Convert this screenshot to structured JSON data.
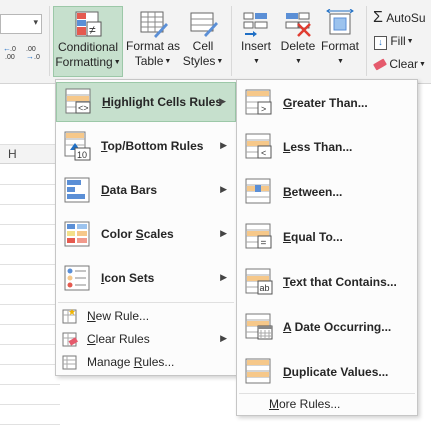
{
  "ribbon": {
    "number_format": {
      "decrease_decimal": "←.0 .00",
      "increase_decimal": ".00 →.0"
    },
    "buttons": {
      "conditional_formatting": {
        "line1": "Conditional",
        "line2": "Formatting"
      },
      "format_as_table": {
        "line1": "Format as",
        "line2": "Table"
      },
      "cell_styles": {
        "line1": "Cell",
        "line2": "Styles"
      },
      "insert": {
        "line1": "Insert"
      },
      "delete": {
        "line1": "Delete"
      },
      "format": {
        "line1": "Format"
      }
    },
    "editing": {
      "autosum": "AutoSu",
      "fill": "Fill",
      "clear": "Clear"
    }
  },
  "sheet": {
    "column_header": "H"
  },
  "menu": {
    "items": [
      {
        "label": "Highlight Cells Rules",
        "u": "H",
        "rest": "ighlight Cells Rules"
      },
      {
        "label": "Top/Bottom Rules",
        "u": "T",
        "rest": "op/Bottom Rules"
      },
      {
        "label": "Data Bars",
        "u": "D",
        "rest": "ata Bars"
      },
      {
        "label": "Color Scales",
        "u": "S",
        "pre": "Color ",
        "rest": "cales"
      },
      {
        "label": "Icon Sets",
        "u": "I",
        "rest": "con Sets"
      }
    ],
    "small_items": [
      {
        "label": "New Rule...",
        "u": "N",
        "rest": "ew Rule..."
      },
      {
        "label": "Clear Rules",
        "u": "C",
        "rest": "lear Rules"
      },
      {
        "label": "Manage Rules...",
        "pre": "Manage ",
        "u": "R",
        "rest": "ules..."
      }
    ]
  },
  "submenu": {
    "items": [
      {
        "label": "Greater Than...",
        "u": "G",
        "rest": "reater Than..."
      },
      {
        "label": "Less Than...",
        "u": "L",
        "rest": "ess Than..."
      },
      {
        "label": "Between...",
        "u": "B",
        "rest": "etween..."
      },
      {
        "label": "Equal To...",
        "u": "E",
        "rest": "qual To..."
      },
      {
        "label": "Text that Contains...",
        "u": "T",
        "rest": "ext that Contains..."
      },
      {
        "label": "A Date Occurring...",
        "u": "A",
        "rest": " Date Occurring..."
      },
      {
        "label": "Duplicate Values...",
        "u": "D",
        "rest": "uplicate Values..."
      }
    ],
    "more_rules": {
      "label": "More Rules...",
      "pre": "",
      "u": "M",
      "rest": "ore Rules..."
    }
  },
  "colors": {
    "highlight": "#c6e0cd",
    "highlight_border": "#9cc8a8",
    "icon_orange": "#f6c88a",
    "icon_blue": "#5b8fd6"
  }
}
